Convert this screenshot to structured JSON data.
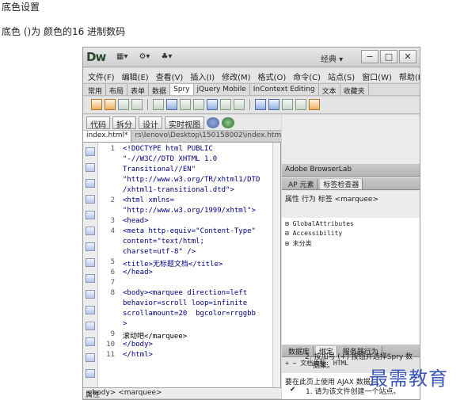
{
  "doc": {
    "heading": "底色设置",
    "desc": "底色 ()为 颜色的16 进制数码"
  },
  "window": {
    "logo": "Dw",
    "workspace": "经典 ▾",
    "tb_icons": [
      "▦▾",
      "⚙▾",
      "♣▾"
    ],
    "buttons": [
      "−",
      "□",
      "✕"
    ]
  },
  "menubar": {
    "items": [
      "文件(F)",
      "编辑(E)",
      "查看(V)",
      "插入(I)",
      "修改(M)",
      "格式(O)",
      "命令(C)",
      "站点(S)",
      "窗口(W)",
      "帮助(H)"
    ]
  },
  "insertbar": {
    "tabs": [
      "常用",
      "布局",
      "表单",
      "数据",
      "Spry",
      "jQuery Mobile",
      "InContext Editing",
      "文本",
      "收藏夹"
    ]
  },
  "viewbar": {
    "code": "代码",
    "split": "拆分",
    "design": "设计",
    "live": "实时视图"
  },
  "file": {
    "tab": "index.html*",
    "path": "rs\\lenovo\\Desktop\\150158002\\index.html"
  },
  "editor": {
    "line_numbers": [
      "1",
      "2",
      "3",
      "4",
      "5",
      "6",
      "7",
      "8",
      "9",
      "10",
      "11"
    ],
    "lines": [
      "<!DOCTYPE html PUBLIC",
      "\"-//W3C//DTD XHTML 1.0",
      "Transitional//EN\"",
      "\"http://www.w3.org/TR/xhtml1/DTD",
      "/xhtml1-transitional.dtd\">",
      "<html xmlns=",
      "\"http://www.w3.org/1999/xhtml\">",
      "<head>",
      "<meta http-equiv=\"Content-Type\"",
      "content=\"text/html;",
      "charset=utf-8\" />",
      "<title>无标题文档</title>",
      "</head>",
      "",
      "<body><marquee direction=left",
      "behavior=scroll loop=infinite",
      "scrollamount=20  bgcolor=rrggbb",
      ">",
      "滚动吧</marquee>",
      "</body>",
      "</html>"
    ]
  },
  "status": {
    "tags": "<body> <marquee>",
    "props": "属性"
  },
  "panels": {
    "browserlab": "Adobe BrowserLab",
    "ap_tabs": [
      "AP 元素",
      "标签检查器"
    ],
    "attr_tabs": "属性  行为  标签 <marquee>",
    "attr_rows": [
      "⊞ GlobalAttributes",
      "⊞ Accessibility",
      "⊞ 未分类"
    ],
    "db_tabs": [
      "数据库",
      "绑定",
      "服务器行为"
    ],
    "db_row": "+  −   文档类型: HTML",
    "ajax_title": "要在此页上使用 AJAX 数据:",
    "ajax_step1": "1. 请为该文件创建一个站点。",
    "ajax_step2a": "2. 按加号 (+) 按钮并选择Spry 数",
    "ajax_step2b": "据集。",
    "check": "✔"
  },
  "watermark": "最需教育"
}
